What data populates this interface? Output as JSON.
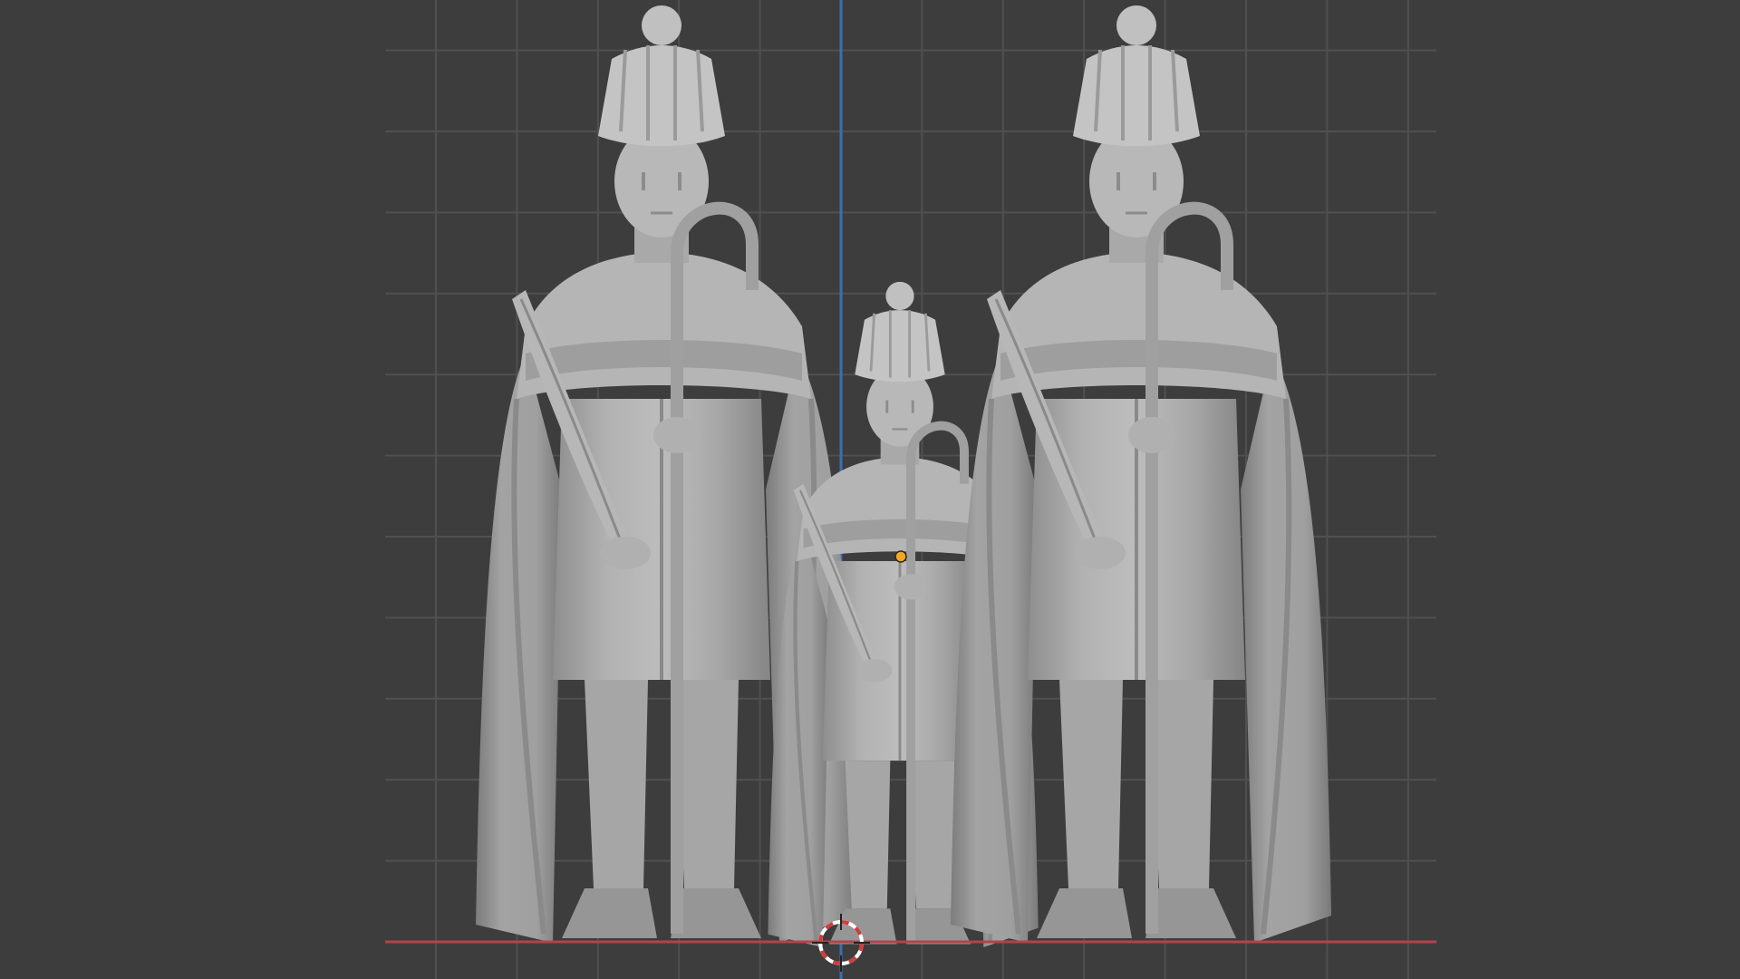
{
  "viewport": {
    "view": "front-orthographic",
    "background_color": "#3d3d3d",
    "grid_color": "#505050",
    "x_axis_color": "#b3424a",
    "z_axis_color": "#3a6fb5",
    "mesh_color": "#a9a9a9",
    "origin_color": "#f5a623",
    "cursor_ring_colors": [
      "#d13c3c",
      "#ffffff"
    ]
  },
  "objects": [
    {
      "name": "shepherd-figure-left",
      "type": "sculpted-mesh"
    },
    {
      "name": "shepherd-figure-child",
      "type": "sculpted-mesh",
      "selected": true
    },
    {
      "name": "shepherd-figure-right",
      "type": "sculpted-mesh"
    }
  ],
  "icons": {
    "3d_cursor": "3d-cursor-icon",
    "origin": "object-origin-icon"
  }
}
